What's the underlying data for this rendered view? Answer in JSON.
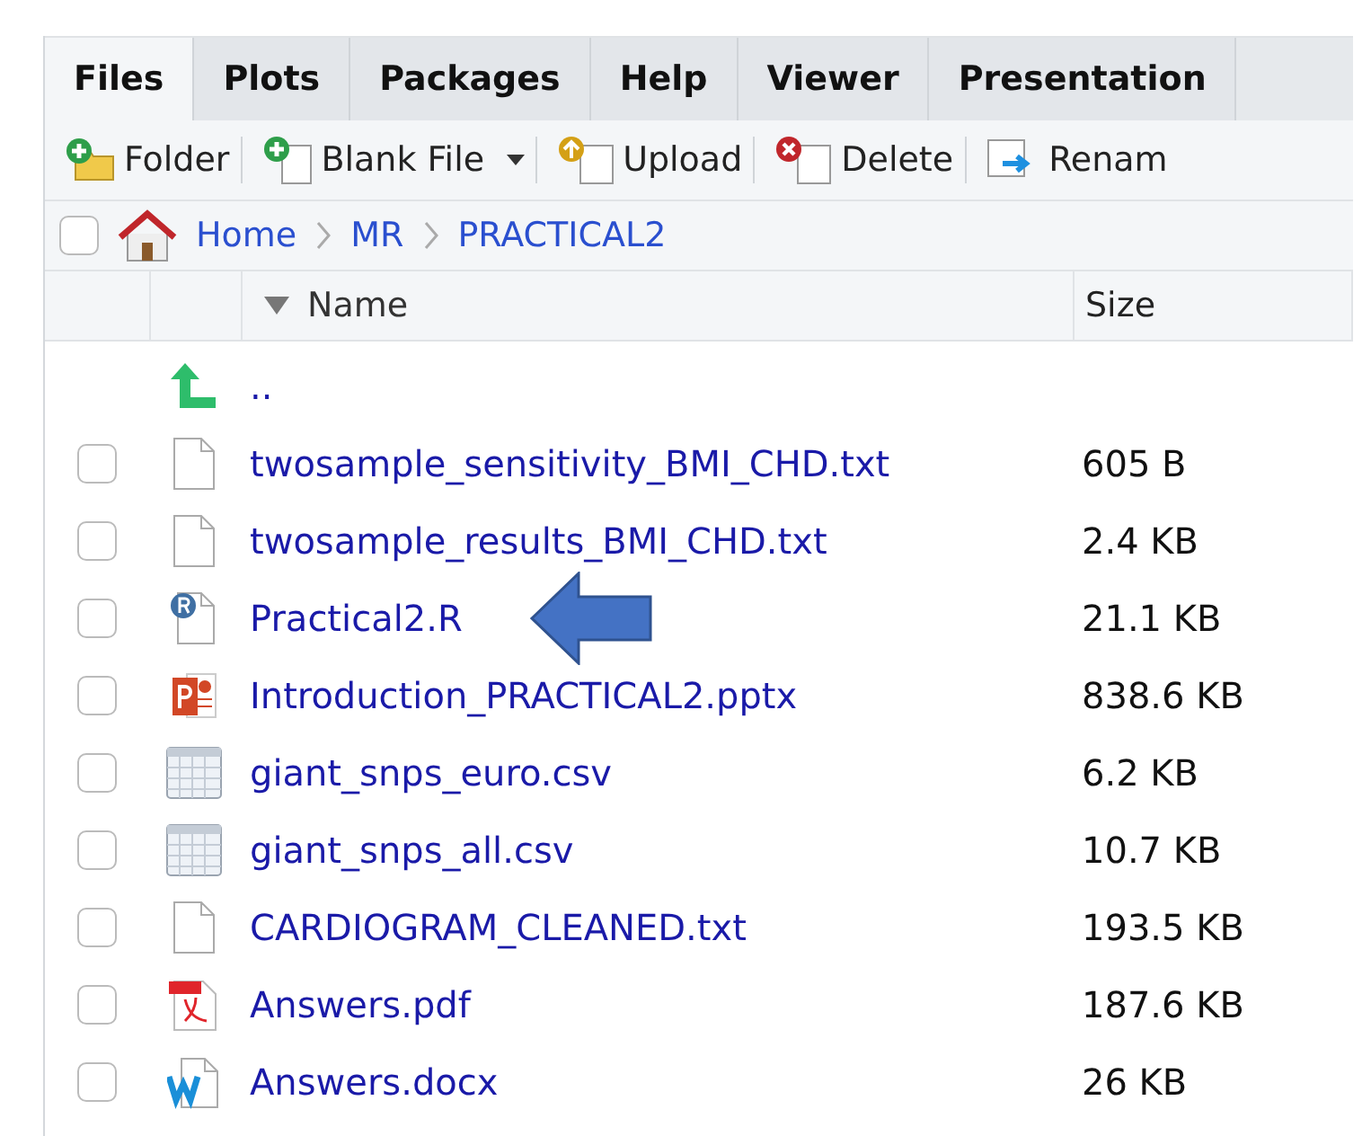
{
  "tabs": [
    {
      "label": "Files",
      "selected": true
    },
    {
      "label": "Plots",
      "selected": false
    },
    {
      "label": "Packages",
      "selected": false
    },
    {
      "label": "Help",
      "selected": false
    },
    {
      "label": "Viewer",
      "selected": false
    },
    {
      "label": "Presentation",
      "selected": false
    }
  ],
  "toolbar": [
    {
      "kind": "folder",
      "label": "Folder"
    },
    {
      "kind": "blank",
      "label": "Blank File",
      "dropdown": true
    },
    {
      "kind": "upload",
      "label": "Upload"
    },
    {
      "kind": "delete",
      "label": "Delete"
    },
    {
      "kind": "rename",
      "label": "Renam"
    }
  ],
  "select_all": {
    "checked": false
  },
  "breadcrumb": [
    "Home",
    "MR",
    "PRACTICAL2"
  ],
  "columns": {
    "name": "Name",
    "size": "Size"
  },
  "parent": {
    "label": ".."
  },
  "files": [
    {
      "kind": "text",
      "name": "twosample_sensitivity_BMI_CHD.txt",
      "size": "605 B",
      "checked": false
    },
    {
      "kind": "text",
      "name": "twosample_results_BMI_CHD.txt",
      "size": "2.4 KB",
      "checked": false
    },
    {
      "kind": "r",
      "name": "Practical2.R",
      "size": "21.1 KB",
      "checked": false,
      "pointer": true
    },
    {
      "kind": "pptx",
      "name": "Introduction_PRACTICAL2.pptx",
      "size": "838.6 KB",
      "checked": false
    },
    {
      "kind": "csv",
      "name": "giant_snps_euro.csv",
      "size": "6.2 KB",
      "checked": false
    },
    {
      "kind": "csv",
      "name": "giant_snps_all.csv",
      "size": "10.7 KB",
      "checked": false
    },
    {
      "kind": "text",
      "name": "CARDIOGRAM_CLEANED.txt",
      "size": "193.5 KB",
      "checked": false
    },
    {
      "kind": "pdf",
      "name": "Answers.pdf",
      "size": "187.6 KB",
      "checked": false
    },
    {
      "kind": "docx",
      "name": "Answers.docx",
      "size": "26 KB",
      "checked": false
    }
  ]
}
